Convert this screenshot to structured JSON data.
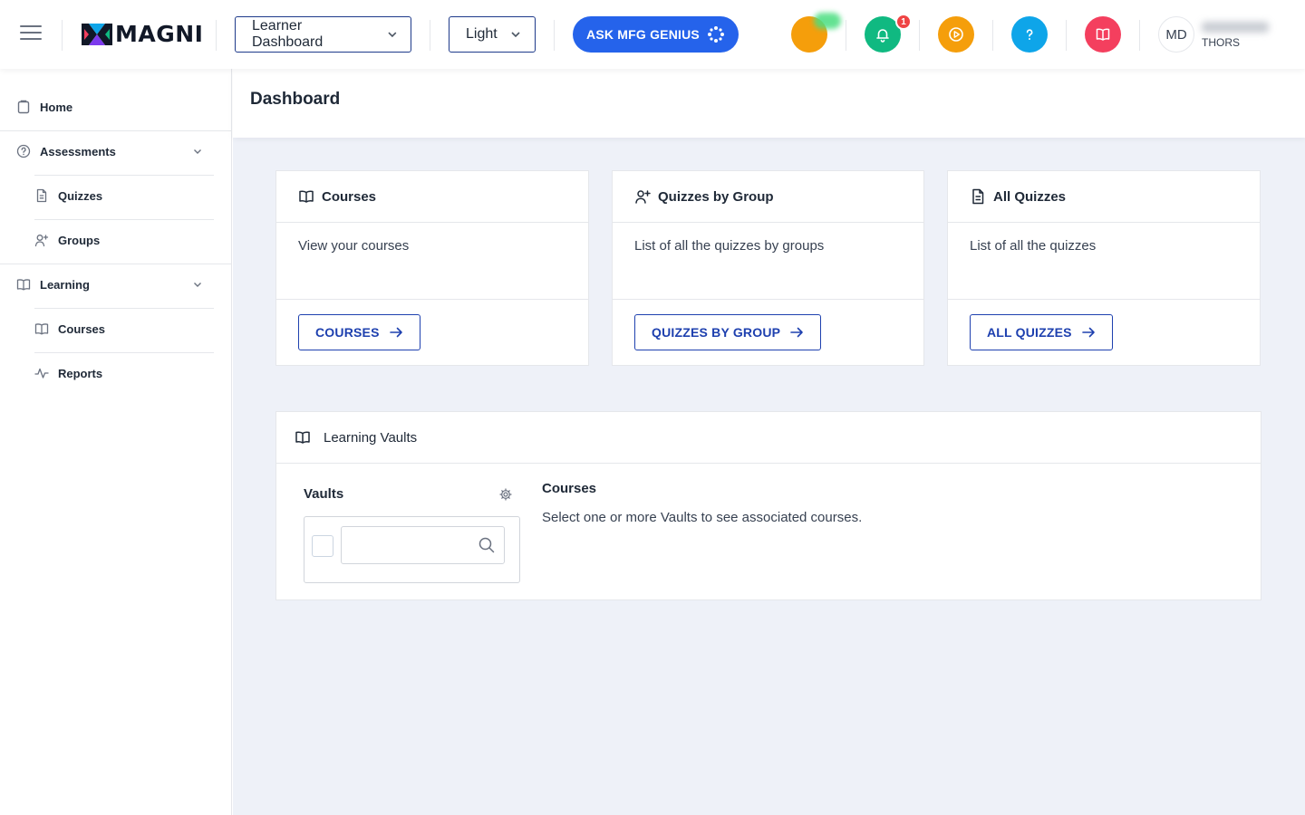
{
  "header": {
    "logo_text": "MAGNI",
    "dashboard_select": "Learner Dashboard",
    "theme_select": "Light",
    "genius_button": "ASK MFG GENIUS",
    "notification_count": "1",
    "avatar_initials": "MD",
    "organization": "THORS"
  },
  "sidebar": {
    "home": "Home",
    "assessments": "Assessments",
    "quizzes": "Quizzes",
    "groups": "Groups",
    "learning": "Learning",
    "courses": "Courses",
    "reports": "Reports"
  },
  "page": {
    "title": "Dashboard"
  },
  "cards": [
    {
      "title": "Courses",
      "description": "View your courses",
      "button": "COURSES"
    },
    {
      "title": "Quizzes by Group",
      "description": "List of all the quizzes by groups",
      "button": "QUIZZES BY GROUP"
    },
    {
      "title": "All Quizzes",
      "description": "List of all the quizzes",
      "button": "ALL QUIZZES"
    }
  ],
  "vaults": {
    "title": "Learning Vaults",
    "vaults_label": "Vaults",
    "search_value": "",
    "courses_label": "Courses",
    "courses_message": "Select one or more Vaults to see associated courses."
  },
  "colors": {
    "primary": "#2563eb",
    "outline": "#1e40af",
    "background": "#eef1f8",
    "status_orange": "#f59e0b",
    "bell_green": "#10b981",
    "help_blue": "#0ea5e9",
    "book_pink": "#f43f5e",
    "badge_red": "#ef4444"
  }
}
